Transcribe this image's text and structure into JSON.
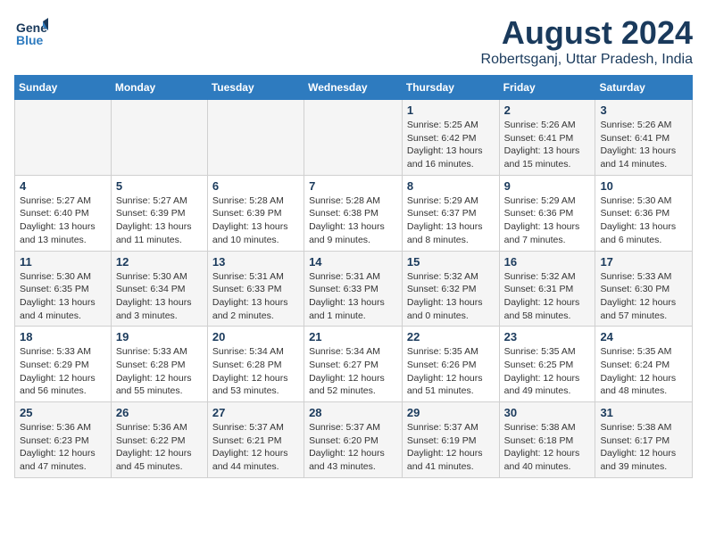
{
  "logo": {
    "line1": "General",
    "line2": "Blue"
  },
  "title": "August 2024",
  "subtitle": "Robertsganj, Uttar Pradesh, India",
  "days_of_week": [
    "Sunday",
    "Monday",
    "Tuesday",
    "Wednesday",
    "Thursday",
    "Friday",
    "Saturday"
  ],
  "weeks": [
    [
      {
        "day": "",
        "info": ""
      },
      {
        "day": "",
        "info": ""
      },
      {
        "day": "",
        "info": ""
      },
      {
        "day": "",
        "info": ""
      },
      {
        "day": "1",
        "info": "Sunrise: 5:25 AM\nSunset: 6:42 PM\nDaylight: 13 hours\nand 16 minutes."
      },
      {
        "day": "2",
        "info": "Sunrise: 5:26 AM\nSunset: 6:41 PM\nDaylight: 13 hours\nand 15 minutes."
      },
      {
        "day": "3",
        "info": "Sunrise: 5:26 AM\nSunset: 6:41 PM\nDaylight: 13 hours\nand 14 minutes."
      }
    ],
    [
      {
        "day": "4",
        "info": "Sunrise: 5:27 AM\nSunset: 6:40 PM\nDaylight: 13 hours\nand 13 minutes."
      },
      {
        "day": "5",
        "info": "Sunrise: 5:27 AM\nSunset: 6:39 PM\nDaylight: 13 hours\nand 11 minutes."
      },
      {
        "day": "6",
        "info": "Sunrise: 5:28 AM\nSunset: 6:39 PM\nDaylight: 13 hours\nand 10 minutes."
      },
      {
        "day": "7",
        "info": "Sunrise: 5:28 AM\nSunset: 6:38 PM\nDaylight: 13 hours\nand 9 minutes."
      },
      {
        "day": "8",
        "info": "Sunrise: 5:29 AM\nSunset: 6:37 PM\nDaylight: 13 hours\nand 8 minutes."
      },
      {
        "day": "9",
        "info": "Sunrise: 5:29 AM\nSunset: 6:36 PM\nDaylight: 13 hours\nand 7 minutes."
      },
      {
        "day": "10",
        "info": "Sunrise: 5:30 AM\nSunset: 6:36 PM\nDaylight: 13 hours\nand 6 minutes."
      }
    ],
    [
      {
        "day": "11",
        "info": "Sunrise: 5:30 AM\nSunset: 6:35 PM\nDaylight: 13 hours\nand 4 minutes."
      },
      {
        "day": "12",
        "info": "Sunrise: 5:30 AM\nSunset: 6:34 PM\nDaylight: 13 hours\nand 3 minutes."
      },
      {
        "day": "13",
        "info": "Sunrise: 5:31 AM\nSunset: 6:33 PM\nDaylight: 13 hours\nand 2 minutes."
      },
      {
        "day": "14",
        "info": "Sunrise: 5:31 AM\nSunset: 6:33 PM\nDaylight: 13 hours\nand 1 minute."
      },
      {
        "day": "15",
        "info": "Sunrise: 5:32 AM\nSunset: 6:32 PM\nDaylight: 13 hours\nand 0 minutes."
      },
      {
        "day": "16",
        "info": "Sunrise: 5:32 AM\nSunset: 6:31 PM\nDaylight: 12 hours\nand 58 minutes."
      },
      {
        "day": "17",
        "info": "Sunrise: 5:33 AM\nSunset: 6:30 PM\nDaylight: 12 hours\nand 57 minutes."
      }
    ],
    [
      {
        "day": "18",
        "info": "Sunrise: 5:33 AM\nSunset: 6:29 PM\nDaylight: 12 hours\nand 56 minutes."
      },
      {
        "day": "19",
        "info": "Sunrise: 5:33 AM\nSunset: 6:28 PM\nDaylight: 12 hours\nand 55 minutes."
      },
      {
        "day": "20",
        "info": "Sunrise: 5:34 AM\nSunset: 6:28 PM\nDaylight: 12 hours\nand 53 minutes."
      },
      {
        "day": "21",
        "info": "Sunrise: 5:34 AM\nSunset: 6:27 PM\nDaylight: 12 hours\nand 52 minutes."
      },
      {
        "day": "22",
        "info": "Sunrise: 5:35 AM\nSunset: 6:26 PM\nDaylight: 12 hours\nand 51 minutes."
      },
      {
        "day": "23",
        "info": "Sunrise: 5:35 AM\nSunset: 6:25 PM\nDaylight: 12 hours\nand 49 minutes."
      },
      {
        "day": "24",
        "info": "Sunrise: 5:35 AM\nSunset: 6:24 PM\nDaylight: 12 hours\nand 48 minutes."
      }
    ],
    [
      {
        "day": "25",
        "info": "Sunrise: 5:36 AM\nSunset: 6:23 PM\nDaylight: 12 hours\nand 47 minutes."
      },
      {
        "day": "26",
        "info": "Sunrise: 5:36 AM\nSunset: 6:22 PM\nDaylight: 12 hours\nand 45 minutes."
      },
      {
        "day": "27",
        "info": "Sunrise: 5:37 AM\nSunset: 6:21 PM\nDaylight: 12 hours\nand 44 minutes."
      },
      {
        "day": "28",
        "info": "Sunrise: 5:37 AM\nSunset: 6:20 PM\nDaylight: 12 hours\nand 43 minutes."
      },
      {
        "day": "29",
        "info": "Sunrise: 5:37 AM\nSunset: 6:19 PM\nDaylight: 12 hours\nand 41 minutes."
      },
      {
        "day": "30",
        "info": "Sunrise: 5:38 AM\nSunset: 6:18 PM\nDaylight: 12 hours\nand 40 minutes."
      },
      {
        "day": "31",
        "info": "Sunrise: 5:38 AM\nSunset: 6:17 PM\nDaylight: 12 hours\nand 39 minutes."
      }
    ]
  ]
}
